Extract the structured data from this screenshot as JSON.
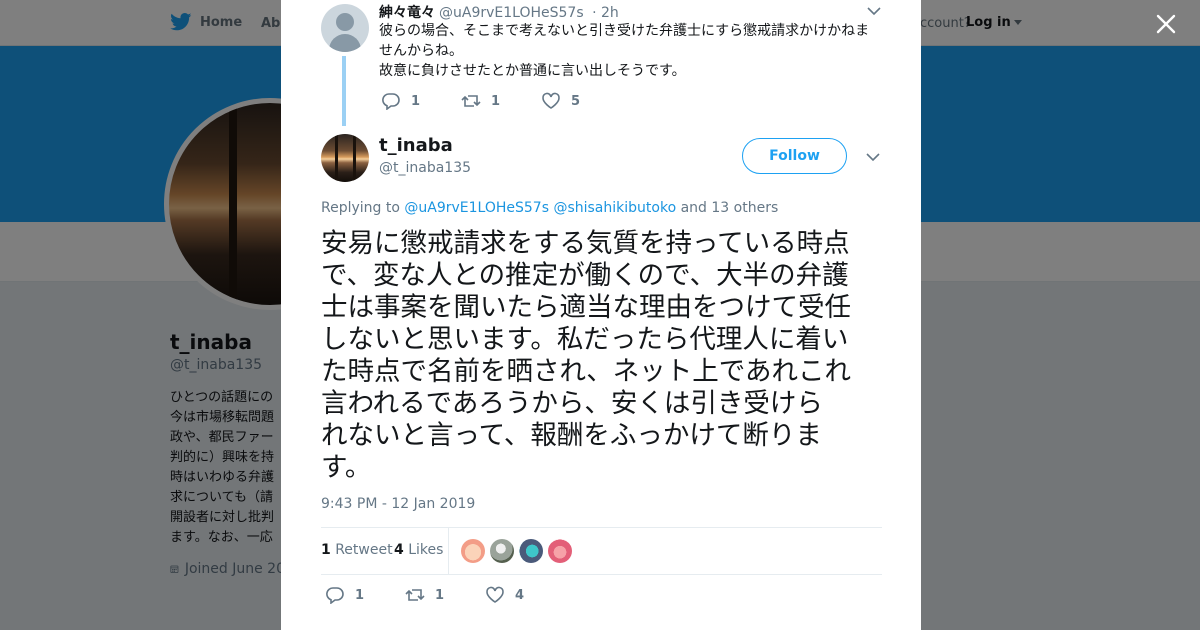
{
  "topbar": {
    "home_label": "Home",
    "about_label": "Abo",
    "account_prompt": "ccount?",
    "login_label": "Log in"
  },
  "profile": {
    "name": "t_inaba",
    "handle": "@t_inaba135",
    "bio_lines": [
      "ひとつの話題にの",
      "今は市場移転問題",
      "政や、都民ファー",
      "判的に）興味を持",
      "時はいわゆる弁護",
      "求についても（請",
      "開設者に対し批判",
      "ます。なお、一応"
    ],
    "joined": "Joined June 20"
  },
  "parent_tweet": {
    "name": "紳々竜々",
    "handle": "@uA9rvE1LOHeS57s",
    "time": "· 2h",
    "text_lines": [
      "彼らの場合、そこまで考えないと引き受けた弁護士にすら懲戒請求かけかねま",
      "せんからね。",
      "故意に負けさせたとか普通に言い出しそうです。"
    ],
    "replies": "1",
    "retweets": "1",
    "likes": "5"
  },
  "main_tweet": {
    "name": "t_inaba",
    "handle": "@t_inaba135",
    "follow_label": "Follow",
    "replying_prefix": "Replying to",
    "replying_user1": "@uA9rvE1LOHeS57s",
    "replying_user2": "@shisahikibutoko",
    "replying_suffix": "and 13 others",
    "text_lines": [
      "安易に懲戒請求をする気質を持っている時点",
      "で、変な人との推定が働くので、大半の弁護",
      "士は事案を聞いたら適当な理由をつけて受任",
      "しないと思います。私だったら代理人に着い",
      "た時点で名前を晒され、ネット上であれこれ",
      "言われるであろうから、安くは引き受けら",
      "れないと言って、報酬をふっかけて断りま",
      "す。"
    ],
    "timestamp": "9:43 PM - 12 Jan 2019",
    "retweet_count": "1",
    "retweet_label": "Retweet",
    "like_count": "4",
    "likes_label": "Likes",
    "replies": "1",
    "retweets": "1",
    "likes": "4"
  },
  "colors": {
    "accent": "#1da1f2",
    "link": "#1b95e0",
    "thread_line": "#9bd0f4"
  }
}
